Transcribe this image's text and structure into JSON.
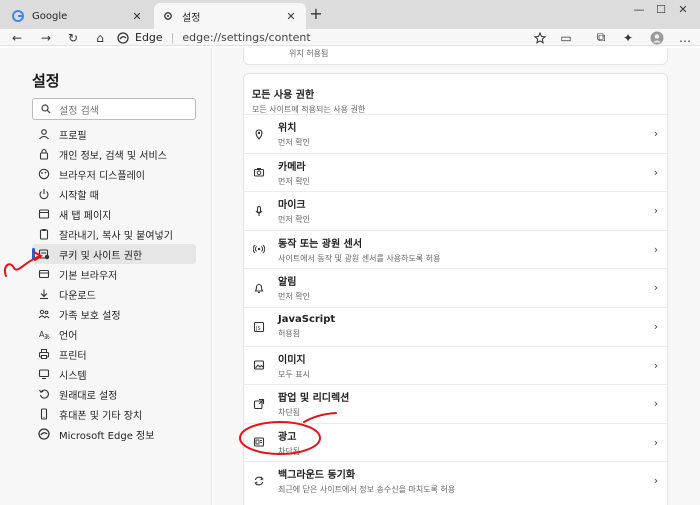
{
  "tabs": [
    {
      "title": "Google",
      "active": false
    },
    {
      "title": "설정",
      "active": true
    }
  ],
  "address": {
    "brand": "Edge",
    "url": "edge://settings/content"
  },
  "sidebar": {
    "title": "설정",
    "search_placeholder": "설정 검색",
    "items": [
      {
        "label": "프로필",
        "icon": "profile-icon"
      },
      {
        "label": "개인 정보, 검색 및 서비스",
        "icon": "privacy-lock-icon"
      },
      {
        "label": "브라우저 디스플레이",
        "icon": "appearance-icon"
      },
      {
        "label": "시작할 때",
        "icon": "power-icon"
      },
      {
        "label": "새 탭 페이지",
        "icon": "new-tab-icon"
      },
      {
        "label": "잘라내기, 복사 및 붙여넣기",
        "icon": "clipboard-icon"
      },
      {
        "label": "쿠키 및 사이트 권한",
        "icon": "site-permissions-icon",
        "active": true
      },
      {
        "label": "기본 브라우저",
        "icon": "default-browser-icon"
      },
      {
        "label": "다운로드",
        "icon": "download-icon"
      },
      {
        "label": "가족 보호 설정",
        "icon": "family-icon"
      },
      {
        "label": "언어",
        "icon": "language-icon"
      },
      {
        "label": "프린터",
        "icon": "printer-icon"
      },
      {
        "label": "시스템",
        "icon": "system-icon"
      },
      {
        "label": "원래대로 설정",
        "icon": "reset-icon"
      },
      {
        "label": "휴대폰 및 기타 장치",
        "icon": "phone-icon"
      },
      {
        "label": "Microsoft Edge 정보",
        "icon": "edge-icon"
      }
    ]
  },
  "main": {
    "top_card_text": "위치 허용됨",
    "section_title": "모든 사용 권한",
    "section_subtitle": "모든 사이트에 적용되는 사용 권한",
    "permissions": [
      {
        "title": "위치",
        "status": "먼저 확인",
        "icon": "location-icon"
      },
      {
        "title": "카메라",
        "status": "먼저 확인",
        "icon": "camera-icon"
      },
      {
        "title": "마이크",
        "status": "먼저 확인",
        "icon": "microphone-icon"
      },
      {
        "title": "동작 또는 광원 센서",
        "status": "사이트에서 동작 및 광원 센서를 사용하도록 허용",
        "icon": "sensor-icon"
      },
      {
        "title": "알림",
        "status": "먼저 확인",
        "icon": "bell-icon"
      },
      {
        "title": "JavaScript",
        "status": "허용됨",
        "icon": "javascript-icon"
      },
      {
        "title": "이미지",
        "status": "모두 표시",
        "icon": "image-icon"
      },
      {
        "title": "팝업 및 리디렉션",
        "status": "차단됨",
        "icon": "popup-icon"
      },
      {
        "title": "광고",
        "status": "차단됨",
        "icon": "ads-icon"
      },
      {
        "title": "백그라운드 동기화",
        "status": "최근에 닫은 사이트에서 정보 송수신을 마치도록 허용",
        "icon": "sync-icon"
      }
    ]
  },
  "colors": {
    "accent": "#2563c9",
    "annotation": "#e3131b"
  }
}
